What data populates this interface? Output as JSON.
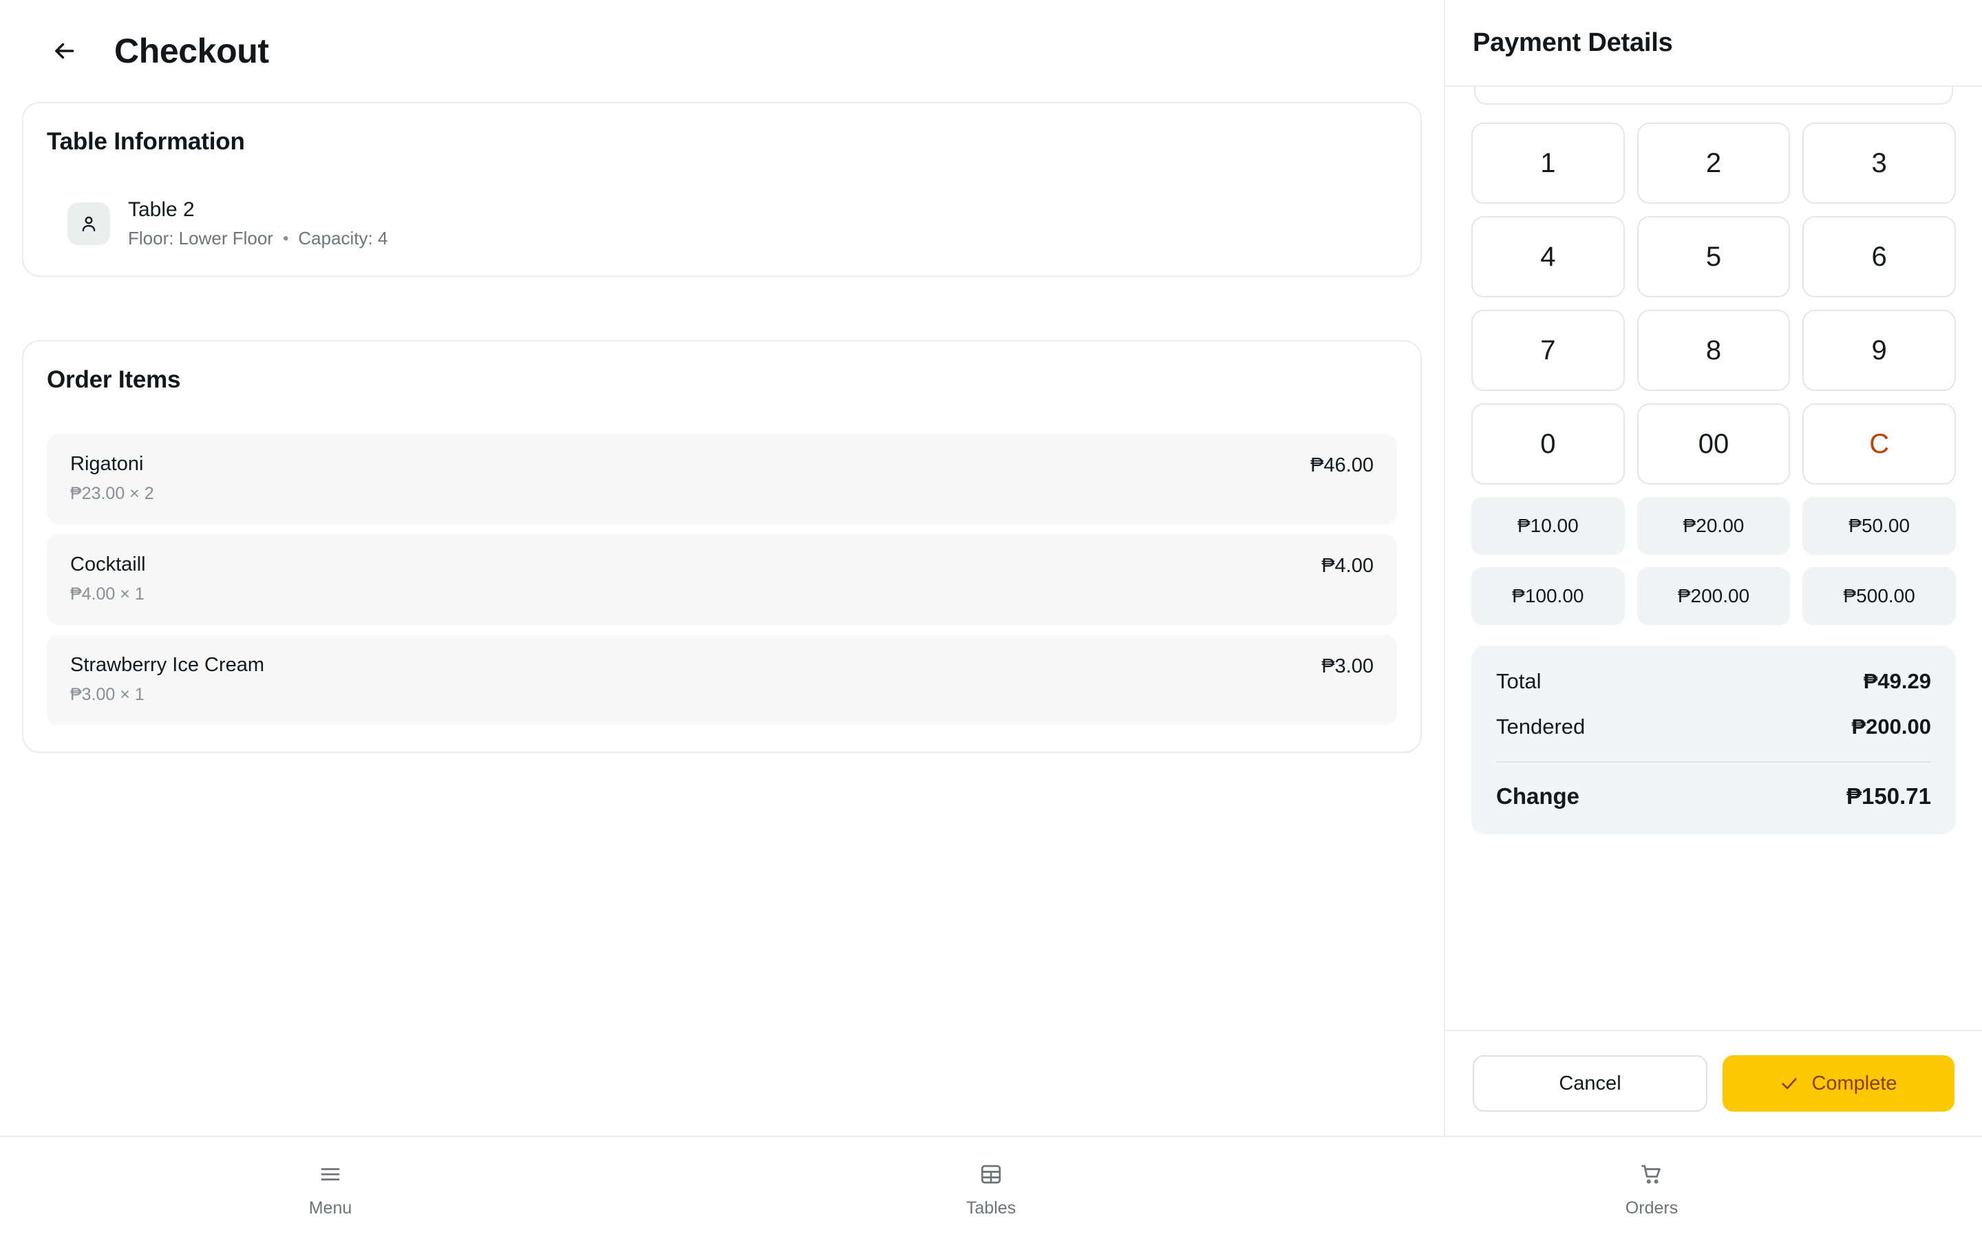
{
  "header": {
    "back_icon": "arrow-left-icon",
    "title": "Checkout"
  },
  "table_information": {
    "card_title": "Table Information",
    "person_icon": "person-icon",
    "table_name": "Table 2",
    "floor_label": "Floor: Lower Floor",
    "separator": "•",
    "capacity_label": "Capacity: 4"
  },
  "order_items": {
    "card_title": "Order Items",
    "items": [
      {
        "name": "Rigatoni",
        "unit_line": "₱23.00 × 2",
        "total": "₱46.00"
      },
      {
        "name": "Cocktaill",
        "unit_line": "₱4.00 × 1",
        "total": "₱4.00"
      },
      {
        "name": "Strawberry Ice Cream",
        "unit_line": "₱3.00 × 1",
        "total": "₱3.00"
      }
    ]
  },
  "payment": {
    "title": "Payment Details",
    "keypad": [
      {
        "label": "1",
        "role": "digit"
      },
      {
        "label": "2",
        "role": "digit"
      },
      {
        "label": "3",
        "role": "digit"
      },
      {
        "label": "4",
        "role": "digit"
      },
      {
        "label": "5",
        "role": "digit"
      },
      {
        "label": "6",
        "role": "digit"
      },
      {
        "label": "7",
        "role": "digit"
      },
      {
        "label": "8",
        "role": "digit"
      },
      {
        "label": "9",
        "role": "digit"
      },
      {
        "label": "0",
        "role": "digit"
      },
      {
        "label": "00",
        "role": "digit"
      },
      {
        "label": "C",
        "role": "clear"
      }
    ],
    "quick_amounts": [
      "₱10.00",
      "₱20.00",
      "₱50.00",
      "₱100.00",
      "₱200.00",
      "₱500.00"
    ],
    "summary": {
      "total_label": "Total",
      "total_value": "₱49.29",
      "tendered_label": "Tendered",
      "tendered_value": "₱200.00",
      "change_label": "Change",
      "change_value": "₱150.71"
    },
    "actions": {
      "cancel_label": "Cancel",
      "complete_label": "Complete",
      "complete_icon": "check-icon"
    }
  },
  "bottom_nav": [
    {
      "label": "Menu",
      "icon": "hamburger-menu-icon"
    },
    {
      "label": "Tables",
      "icon": "table-grid-icon"
    },
    {
      "label": "Orders",
      "icon": "shopping-cart-icon"
    }
  ],
  "colors": {
    "accent_amber": "#fcc800",
    "complete_text": "#8c3b09",
    "clear_key": "#bf4309",
    "muted_text": "#6f737a",
    "card_border": "#ececef",
    "row_bg": "#f7f7f8",
    "summary_bg": "#f3f4f5"
  }
}
